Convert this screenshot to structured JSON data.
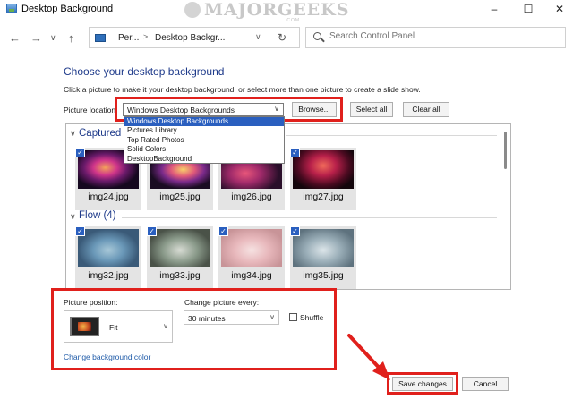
{
  "window": {
    "title": "Desktop Background"
  },
  "watermark": {
    "text": "MAJORGEEKS",
    "sub": ".COM"
  },
  "address": {
    "segments": [
      "Per...",
      "Desktop Backgr..."
    ],
    "separator": ">",
    "search_placeholder": "Search Control Panel"
  },
  "content": {
    "heading": "Choose your desktop background",
    "instructions": "Click a picture to make it your desktop background, or select more than one picture to create a slide show.",
    "location_label": "Picture location:",
    "location_value": "Windows Desktop Backgrounds",
    "browse_label": "Browse...",
    "select_all_label": "Select all",
    "clear_all_label": "Clear all",
    "location_options": [
      "Windows Desktop Backgrounds",
      "Pictures Library",
      "Top Rated Photos",
      "Solid Colors",
      "DesktopBackground"
    ]
  },
  "gallery": {
    "groups": [
      {
        "name": "Captured",
        "items": [
          "img24.jpg",
          "img25.jpg",
          "img26.jpg",
          "img27.jpg"
        ]
      },
      {
        "name": "Flow (4)",
        "items": [
          "img32.jpg",
          "img33.jpg",
          "img34.jpg",
          "img35.jpg"
        ]
      }
    ],
    "check_glyph": "✓",
    "collapse_glyph": "∨"
  },
  "options": {
    "position_label": "Picture position:",
    "position_value": "Fit",
    "interval_label": "Change picture every:",
    "interval_value": "30 minutes",
    "shuffle_label": "Shuffle",
    "shuffle_checked": false,
    "color_link": "Change background color"
  },
  "footer": {
    "save_label": "Save changes",
    "cancel_label": "Cancel"
  },
  "colors": {
    "accent": "#2a5fbf",
    "annotation": "#e0201c",
    "heading": "#1e3a8a"
  }
}
